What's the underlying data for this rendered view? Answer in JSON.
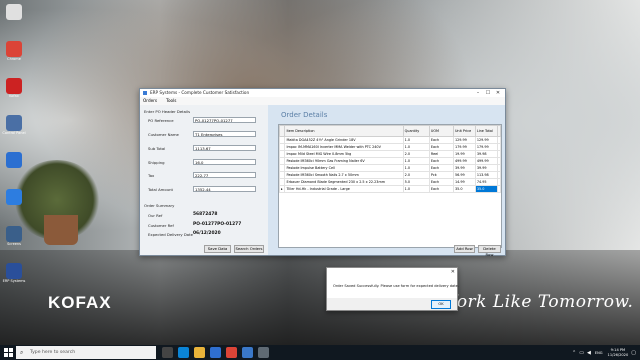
{
  "desktop": {
    "icons": [
      {
        "label": "",
        "color": "#e0e0e0",
        "icon": "recycle-bin-icon"
      },
      {
        "label": "Chrome",
        "color": "#db4437",
        "icon": "chrome-icon"
      },
      {
        "label": "Kofax",
        "color": "#cc2222",
        "icon": "app-icon"
      },
      {
        "label": "Control Panel",
        "color": "#4a6fa5",
        "icon": "app-icon"
      },
      {
        "label": "",
        "color": "#2b6fd1",
        "icon": "app-icon"
      },
      {
        "label": "",
        "color": "#2d7de0",
        "icon": "app-icon"
      },
      {
        "label": "Screens",
        "color": "#3a5f8a",
        "icon": "app-icon"
      },
      {
        "label": "ERP Systems",
        "color": "#2a4f9a",
        "icon": "app-icon"
      }
    ],
    "brand": "KOFAX",
    "tagline": "Work Like Tomorrow."
  },
  "window": {
    "title": "ERP Systems - Complete Customer Satisfaction",
    "menu": [
      "Orders",
      "Tools"
    ],
    "header_group_title": "Enter PO Header Details",
    "fields": [
      {
        "label": "PO Reference",
        "value": "PO-01277PO-01277"
      },
      {
        "label": "Customer Name",
        "value": "T1 Enterprises"
      },
      {
        "label": "Sub Total",
        "value": "1113.67"
      },
      {
        "label": "Shipping",
        "value": "16.0"
      },
      {
        "label": "Tax",
        "value": "222.77"
      },
      {
        "label": "Total Amount",
        "value": "1352.44"
      }
    ],
    "summary_title": "Order Summary",
    "summary": [
      {
        "label": "Our Ref",
        "value": "56872478"
      },
      {
        "label": "Customer Ref",
        "value": "PO-01277PO-01277"
      },
      {
        "label": "Expected Delivery Date",
        "value": "06/12/2020"
      }
    ],
    "buttons": {
      "save": "Save Data",
      "search": "Search Orders",
      "add_row": "Add Row",
      "delete_row": "Delete Row"
    },
    "order_details_title": "Order Details",
    "columns": [
      "Item Description",
      "Quantity",
      "UOM",
      "Unit Price",
      "Line Total"
    ],
    "rows": [
      [
        "Makita DGA452Z 4½\" Angle Grinder 18V",
        "1.0",
        "Each",
        "129.99",
        "129.99"
      ],
      [
        "Impac IM-MMA160I Inverter MMA Welder with PTC 240V",
        "1.0",
        "Each",
        "179.99",
        "179.99"
      ],
      [
        "Impac Mild Steel MIG Wire 0.8mm 5kg",
        "2.0",
        "Reel",
        "19.99",
        "39.98"
      ],
      [
        "Paslode IM360ci 90mm Gas Framing Nailer 6V",
        "1.0",
        "Each",
        "499.99",
        "499.99"
      ],
      [
        "Paslode Impulse Battery Cell",
        "1.0",
        "Each",
        "39.99",
        "39.99"
      ],
      [
        "Paslode IM360ci Smooth Nails 2.7 x 50mm",
        "2.0",
        "Pck",
        "56.99",
        "113.98"
      ],
      [
        "Erbauer Diamond Blade Segmented 230 x 2.5 x 22.23mm",
        "5.0",
        "Each",
        "14.99",
        "74.95"
      ],
      [
        "Tiller Hd-Hk - Industrial Grade - Large",
        "1.0",
        "Each",
        "35.0",
        "35.0"
      ]
    ]
  },
  "dialog": {
    "message": "Order Saved Successfully. Please use form for expected delivery date.",
    "ok": "OK"
  },
  "taskbar": {
    "search_placeholder": "Type here to search",
    "language": "ENG",
    "time": "9:14 PM",
    "date": "11/26/2020"
  }
}
